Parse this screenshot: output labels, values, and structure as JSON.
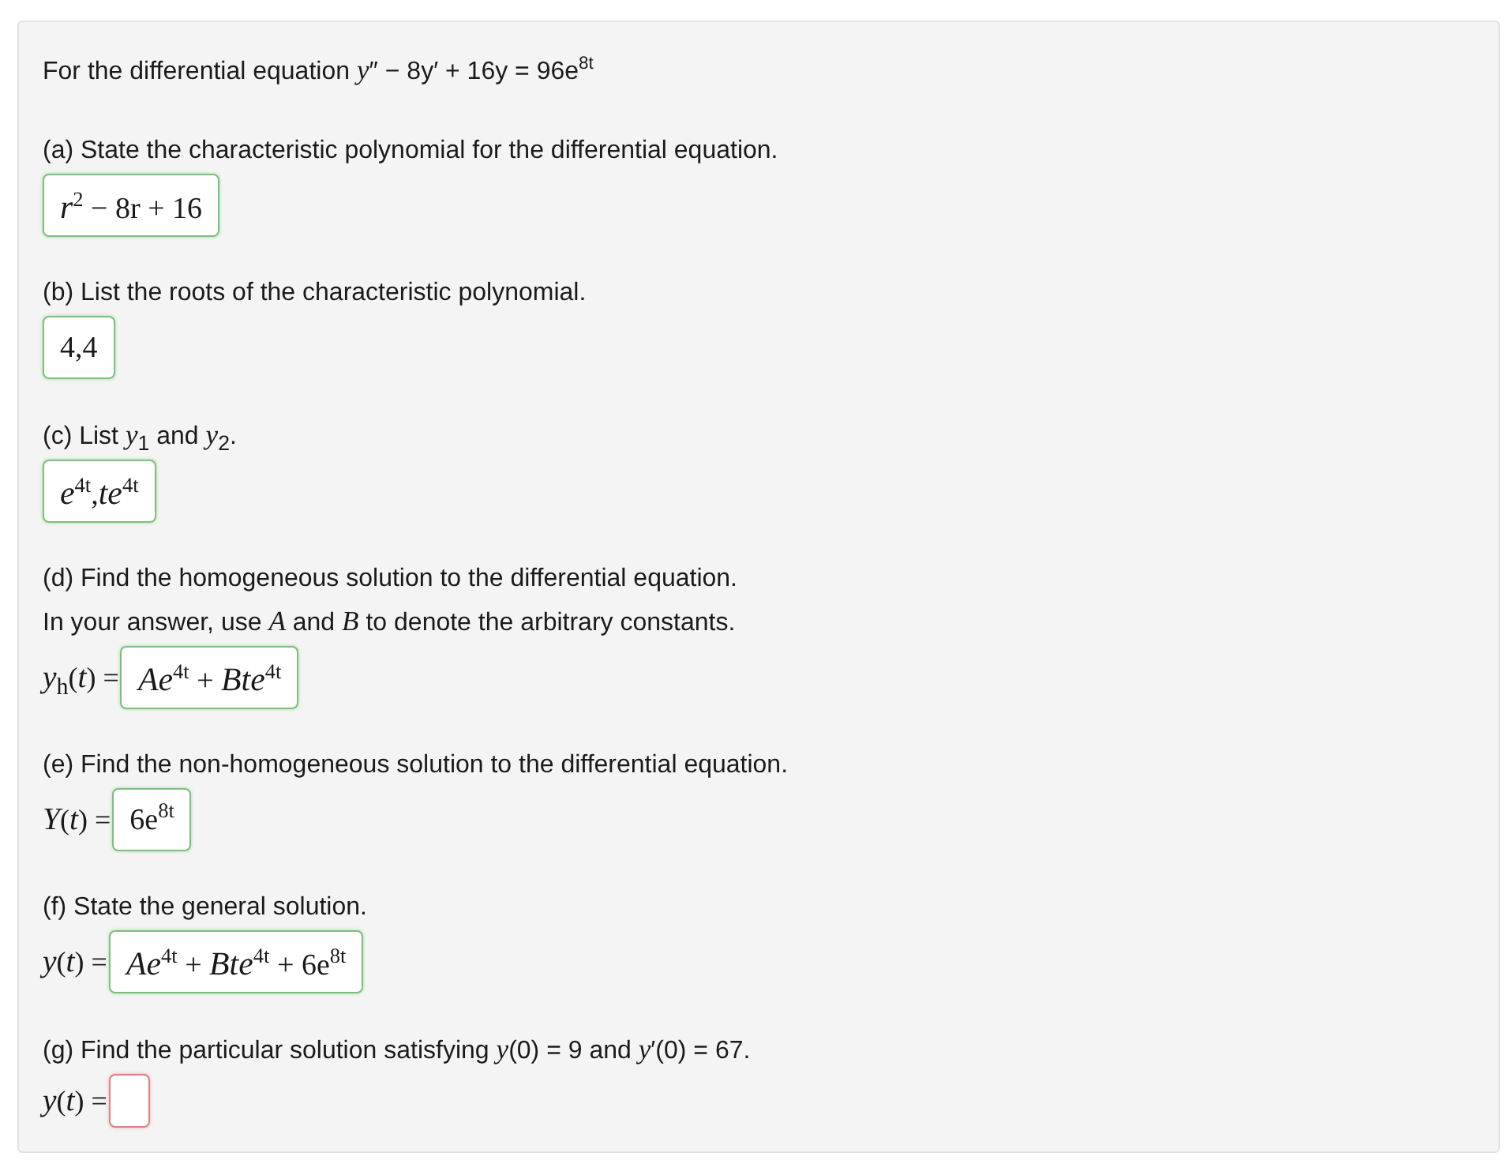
{
  "intro": "For the differential equation *y*″ − 8y′ + 16y = 96e$^{8t}$",
  "parts": [
    {
      "prompt_lines": [
        "(a) State the characteristic polynomial for the differential equation."
      ],
      "answer": {
        "value": "*r*$^{2}$ − 8r + 16",
        "correct": true
      }
    },
    {
      "prompt_lines": [
        "(b) List the roots of the characteristic polynomial."
      ],
      "answer": {
        "value": "4,4",
        "correct": true
      }
    },
    {
      "prompt_lines": [
        "(c) List *y*$_{1}$ and *y*$_{2}$."
      ],
      "answer": {
        "value": "*e*$^{4t}$,*te*$^{4t}$",
        "correct": true
      }
    },
    {
      "prompt_lines": [
        "(d) Find the homogeneous solution to the differential equation.",
        "In your answer, use *A* and *B* to denote the arbitrary constants."
      ],
      "label": "*y*$_{h}$(*t*) =",
      "answer": {
        "value": "*Ae*$^{4t}$ + *Bte*$^{4t}$",
        "correct": true
      }
    },
    {
      "prompt_lines": [
        "(e) Find the non-homogeneous solution to the differential equation."
      ],
      "label": "*Y*(*t*) =",
      "answer": {
        "value": "6e$^{8t}$",
        "correct": true
      }
    },
    {
      "prompt_lines": [
        "(f) State the general solution."
      ],
      "label": "*y*(*t*) =",
      "answer": {
        "value": "*Ae*$^{4t}$ + *Bte*$^{4t}$ + 6e$^{8t}$",
        "correct": true
      }
    },
    {
      "prompt_lines": [
        "(g) Find the particular solution satisfying *y*(0) = 9 and *y*′(0) = 67."
      ],
      "label": "*y*(*t*) =",
      "answer": {
        "correct": false
      }
    }
  ]
}
